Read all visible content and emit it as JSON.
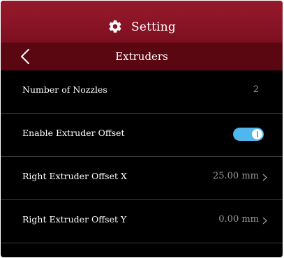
{
  "header": {
    "title": "Setting",
    "icon": "gear-icon"
  },
  "subheader": {
    "title": "Extruders",
    "back_icon": "chevron-left-icon"
  },
  "settings": [
    {
      "label": "Number of Nozzles",
      "value": "2"
    },
    {
      "label": "Enable Extruder Offset",
      "toggle_on": true
    },
    {
      "label": "Right Extruder Offset X",
      "value": "25.00 mm"
    },
    {
      "label": "Right Extruder Offset Y",
      "value": "0.00 mm"
    }
  ],
  "colors": {
    "header_bg": "#8a1426",
    "subheader_bg": "#5a0712",
    "toggle_on": "#4fb6ee",
    "value_text": "#9a9a9a"
  }
}
